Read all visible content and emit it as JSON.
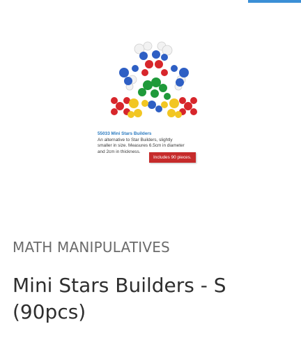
{
  "accent_color": "#3b8fd6",
  "product": {
    "image_icon": "mini-stars-builders-photo",
    "image_caption": {
      "code_title": "55033  Mini Stars Builders",
      "line1": "An alternative to Star Builders, slightly",
      "line2": "smaller in size. Measures 6.5cm in diameter",
      "line3": "and 2cm in thickness."
    },
    "image_badge": "Includes 90 pieces.",
    "category": "MATH MANIPULATIVES",
    "title": "Mini Stars Builders - S (90pcs)"
  }
}
